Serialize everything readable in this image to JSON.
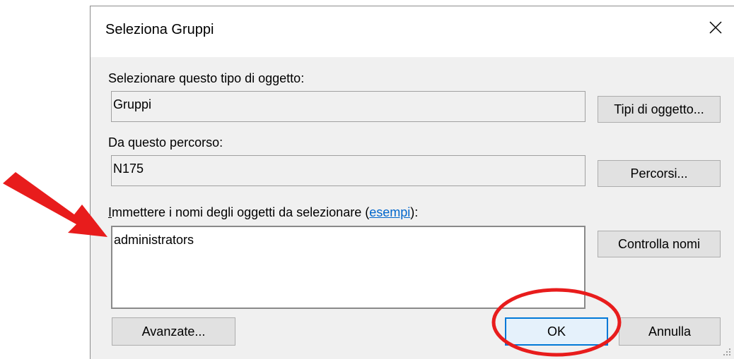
{
  "dialog": {
    "title": "Seleziona Gruppi",
    "object_type": {
      "label_before": "Selezionare questo tipo di oggetto",
      "label_after": ":",
      "value": "Gruppi",
      "button_label": "Tipi di oggetto..."
    },
    "location": {
      "label": "Da questo percorso:",
      "value": "N175",
      "button_label": "Percorsi..."
    },
    "names": {
      "label_prefix_underlined": "I",
      "label_text": "mmettere i nomi degli oggetti da selezionare (",
      "link_label": "esempi",
      "label_suffix": "):",
      "value": "administrators",
      "check_button_label": "Controlla nomi"
    },
    "buttons": {
      "advanced": "Avanzate...",
      "ok": "OK",
      "cancel": "Annulla"
    }
  },
  "annotations": {
    "arrow_color": "#e81c1c",
    "circle_color": "#e81c1c"
  }
}
